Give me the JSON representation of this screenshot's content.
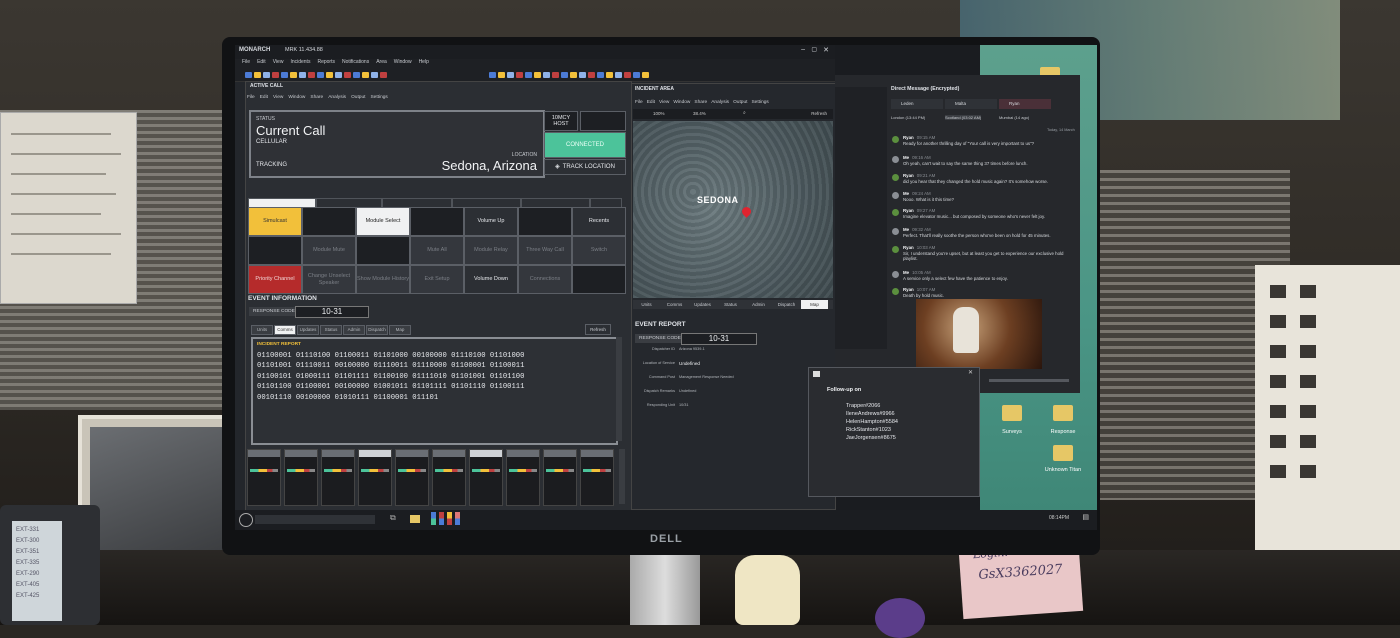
{
  "app": {
    "name": "MONARCH",
    "version": "MRK 11.434.88",
    "menu": [
      "File",
      "Edit",
      "View",
      "Incidents",
      "Reports",
      "Notifications",
      "Area",
      "Window",
      "Help"
    ]
  },
  "active_call": {
    "panel_title": "ACTIVE CALL",
    "menu": [
      "File",
      "Edit",
      "View",
      "Window",
      "Share",
      "Analysis",
      "Output",
      "Settings"
    ],
    "status_label": "STATUS",
    "status_value": "Current Call",
    "status_sub": "CELLULAR",
    "tracking_label": "TRACKING",
    "location_label": "LOCATION",
    "location_value": "Sedona, Arizona",
    "host_label": "10MCY HOST",
    "connected": "CONNECTED",
    "track_location": "TRACK LOCATION",
    "tabs": [
      {
        "label": "Crisis Management",
        "code": ""
      },
      {
        "label": "Rapid Response",
        "code": "Rx"
      },
      {
        "label": "Search and Rescue",
        "code": "SAR"
      },
      {
        "label": "Disaster Mitigation",
        "code": "DMT"
      },
      {
        "label": "Dispatch",
        "code": "DIS"
      },
      {
        "label": "Man",
        "code": ""
      }
    ],
    "buttons": {
      "simulcast": "Simulcast",
      "module_select": "Module Select",
      "volume_up": "Volume Up",
      "recents": "Recents",
      "module_mute": "Module Mute",
      "mute_all": "Mute All",
      "module_relay": "Module Relay",
      "three_way": "Three Way Call",
      "switch": "Switch",
      "priority": "Priority Channel",
      "change_speaker": "Change Unselect Speaker",
      "show_history": "Show Module History",
      "exit_setup": "Exit Setup",
      "volume_down": "Volume Down",
      "connections": "Connections"
    }
  },
  "event_info": {
    "title": "EVENT INFORMATION",
    "response_code_label": "RESPONSE CODE:",
    "response_code": "10-31",
    "tabs": [
      "Units",
      "Comms",
      "Updates",
      "Status",
      "Admin",
      "Dispatch",
      "Map"
    ],
    "refresh": "Refresh",
    "report_header": "INCIDENT REPORT",
    "binary": [
      "01100001 01110100 01100011 01101000 00100000 01110100 01101000",
      "01101001 01110011 00100000 01110011 01110000 01100001 01100011",
      "01100101 01000111 01101111 01100100 01111010 01101001 01101100",
      "01101100 01100001 00100000 01001011 01101111 01101110 01100111",
      "00101110 00100000 01010111 01100001 011101"
    ]
  },
  "incident_area": {
    "title": "INCIDENT AREA",
    "menu": [
      "File",
      "Edit",
      "View",
      "Window",
      "Share",
      "Analysis",
      "Output",
      "Settings"
    ],
    "zoom": "100%",
    "scale": "38.4%",
    "refresh": "Refresh",
    "map_label": "SEDONA",
    "tabs": [
      "Units",
      "Comms",
      "Updates",
      "Status",
      "Admin",
      "Dispatch",
      "Map"
    ]
  },
  "event_report": {
    "title": "EVENT REPORT",
    "response_code_label": "RESPONSE CODE:",
    "response_code": "10-31",
    "rows": [
      {
        "k": "Dispatcher ID",
        "v": "Arizona 9539-1"
      },
      {
        "k": "Location of Service",
        "v": "Undefined"
      },
      {
        "k": "Command Post",
        "v": "Management Response Needed"
      },
      {
        "k": "Dispatch Remarks",
        "v": "Undefined"
      },
      {
        "k": "Responding Unit",
        "v": "10/31"
      }
    ]
  },
  "chat": {
    "title": "Direct Message (Encrypted)",
    "tabs": [
      "Leden",
      "Malta",
      "Ryan"
    ],
    "sub_tabs": [
      "London (13:44 PM)",
      "Scotland (03:02 AM)",
      "Mumbai (14 ago)"
    ],
    "date": "Today, 14 March",
    "messages": [
      {
        "who": "Ryan",
        "time": "09:15 AM",
        "text": "Ready for another thrilling day of \"Your call is very important to us\"?"
      },
      {
        "who": "Me",
        "time": "09:16 AM",
        "text": "Oh yeah, can't wait to say the same thing 37 times before lunch."
      },
      {
        "who": "Ryan",
        "time": "09:21 AM",
        "text": "did you hear that they changed the hold music again? It's somehow worse."
      },
      {
        "who": "Me",
        "time": "09:24 AM",
        "text": "Nooo. What is it this time?"
      },
      {
        "who": "Ryan",
        "time": "09:27 AM",
        "text": "Imagine elevator music... but composed by someone who's never felt joy."
      },
      {
        "who": "Me",
        "time": "09:32 AM",
        "text": "Perfect. That'll really soothe the person who've been on hold for 45 minutes."
      },
      {
        "who": "Ryan",
        "time": "10:03 AM",
        "text": "Sir, I understand you're upset, but at least you get to experience our exclusive hold playlist."
      },
      {
        "who": "Me",
        "time": "10:05 AM",
        "text": "A service only a select few have the patience to enjoy."
      },
      {
        "who": "Ryan",
        "time": "10:07 AM",
        "text": "Death by hold music."
      }
    ]
  },
  "followup": {
    "title": "Follow-up on",
    "names": [
      "Trapper#2066",
      "IleneAndrews#9966",
      "HelenHampton#5584",
      "RickStanton#1023",
      "JaeJorgensen#8675"
    ]
  },
  "desktop": {
    "folders": [
      "Surveys",
      "Response",
      "Unknown Titan"
    ]
  },
  "taskbar": {
    "time": "08:14PM"
  },
  "sticky_note": {
    "line1": "Login:",
    "line2": "GsX3362027"
  },
  "monitor_brand": "DELL",
  "phone_lines": [
    "EXT-331",
    "EXT-300",
    "EXT-351",
    "EXT-335",
    "EXT-290",
    "EXT-405",
    "EXT-425"
  ],
  "colors": {
    "connected": "#4cc39a",
    "simulcast": "#f2c03a",
    "priority": "#b52b2b",
    "map_pin": "#e0232f",
    "desktop": "#4a9585"
  }
}
